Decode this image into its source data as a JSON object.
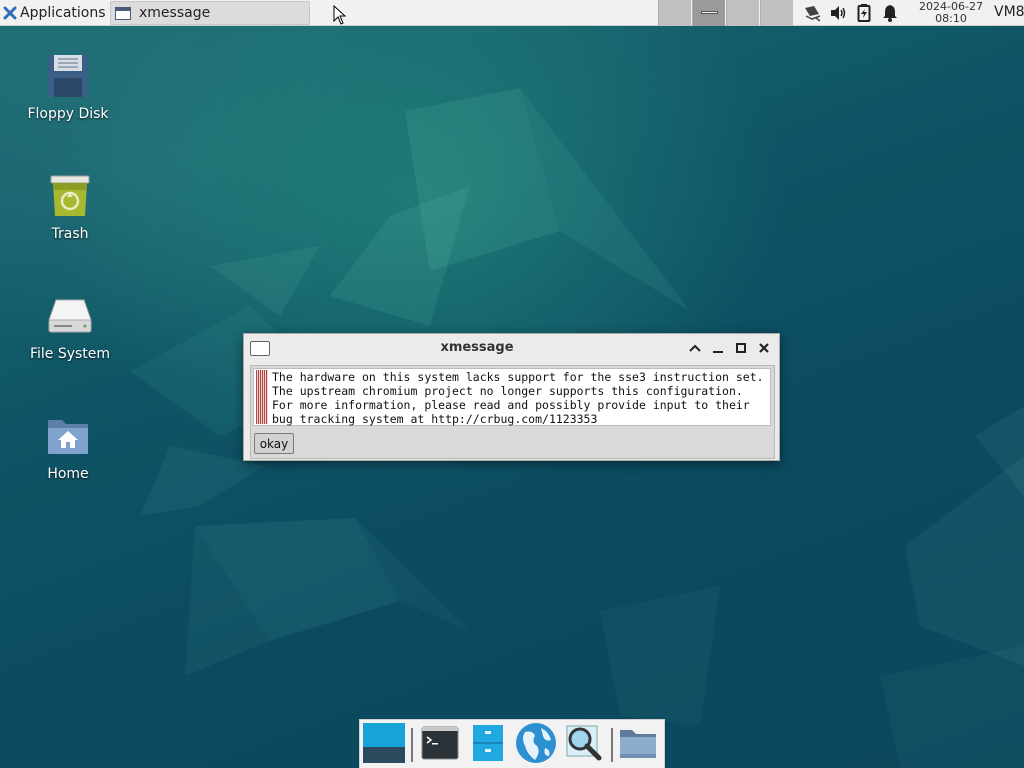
{
  "top_panel": {
    "apps_menu_label": "Applications",
    "apps_menu_arrow": "⋮",
    "task_title": "xmessage",
    "clock_date": "2024-06-27",
    "clock_time": "08:10",
    "user_label": "VM8"
  },
  "desktop_icons": [
    {
      "label": "Floppy Disk",
      "icon": "floppy-disk-icon"
    },
    {
      "label": "Trash",
      "icon": "trash-icon"
    },
    {
      "label": "File System",
      "icon": "hard-drive-icon"
    },
    {
      "label": "Home",
      "icon": "home-folder-icon"
    }
  ],
  "dialog": {
    "title": "xmessage",
    "message_lines": [
      "The hardware on this system lacks support for the sse3 instruction set.",
      "The upstream chromium project no longer supports this configuration.",
      "For more information, please read and possibly provide input to their",
      "bug tracking system at http://crbug.com/1123353"
    ],
    "button_label": "okay"
  },
  "dock": {
    "items": [
      "show-desktop-icon",
      "terminal-icon",
      "file-manager-icon",
      "web-browser-icon",
      "app-finder-icon",
      "folder-icon"
    ]
  },
  "colors": {
    "wallpaper": "#0d4f5e",
    "panel": "#f1f1f0",
    "dialog_bg": "#ecebea",
    "dock_accent": "#18a3d8"
  }
}
